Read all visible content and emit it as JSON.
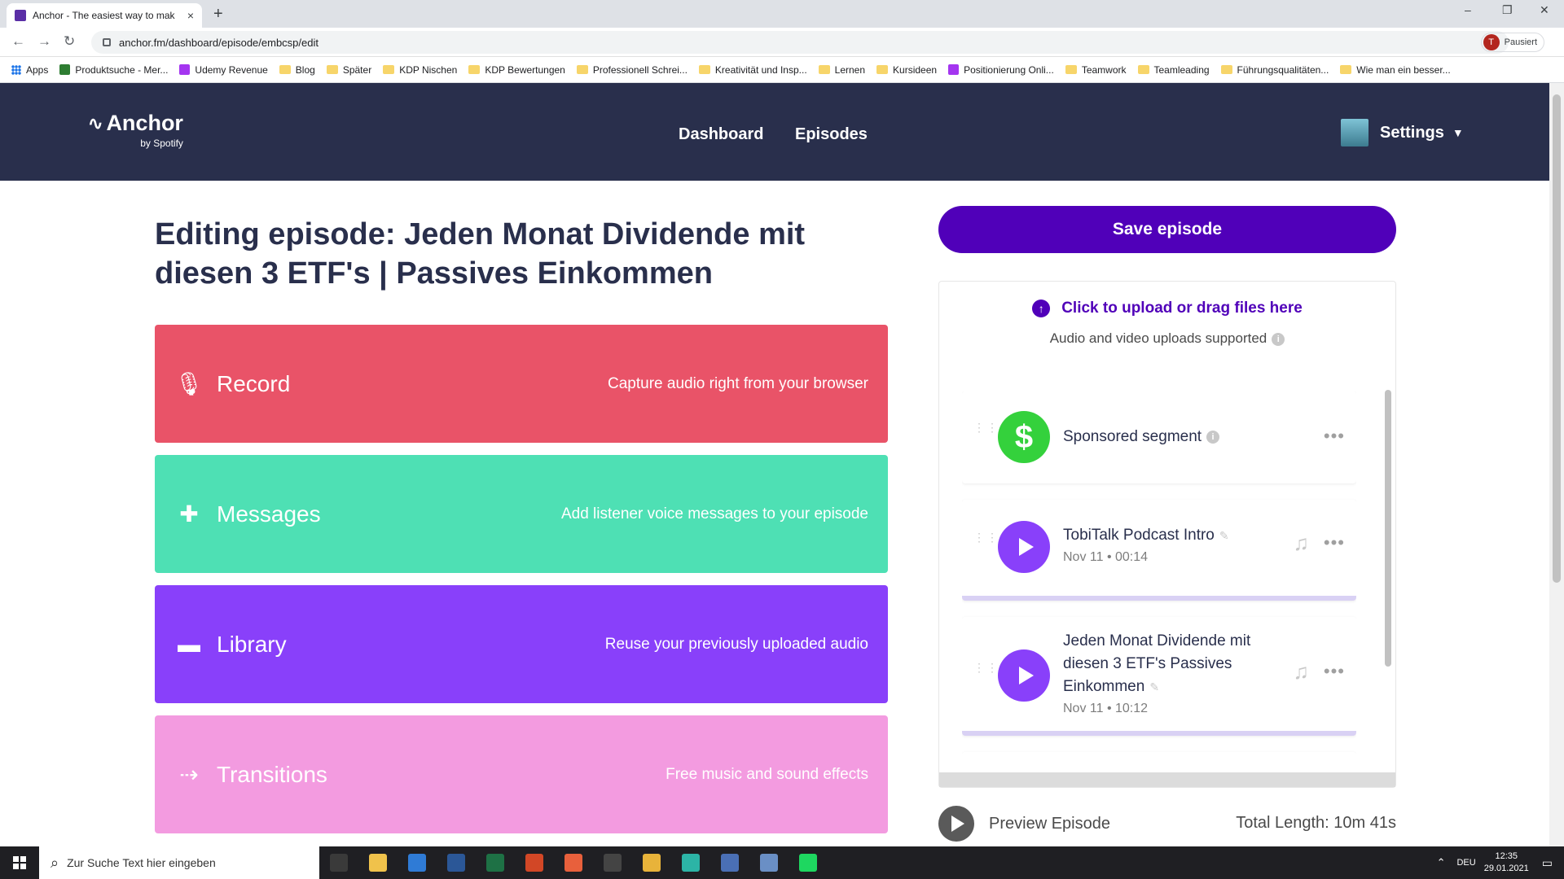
{
  "browser": {
    "tab_title": "Anchor - The easiest way to mak",
    "tab_close": "×",
    "new_tab": "+",
    "url": "anchor.fm/dashboard/episode/embcsp/edit",
    "profile_initial": "T",
    "profile_status": "Pausiert",
    "win_min": "–",
    "win_max": "❐",
    "win_close": "✕",
    "back": "←",
    "forward": "→",
    "reload": "↻",
    "bookmarks": [
      {
        "label": "Apps",
        "icon": "apps-grid-icon"
      },
      {
        "label": "Produktsuche - Mer...",
        "icon": "site-icon"
      },
      {
        "label": "Udemy Revenue",
        "icon": "udemy-icon"
      },
      {
        "label": "Blog",
        "icon": "folder-icon"
      },
      {
        "label": "Später",
        "icon": "folder-icon"
      },
      {
        "label": "KDP Nischen",
        "icon": "folder-icon"
      },
      {
        "label": "KDP Bewertungen",
        "icon": "folder-icon"
      },
      {
        "label": "Professionell Schrei...",
        "icon": "folder-icon"
      },
      {
        "label": "Kreativität und Insp...",
        "icon": "folder-icon"
      },
      {
        "label": "Lernen",
        "icon": "folder-icon"
      },
      {
        "label": "Kursideen",
        "icon": "folder-icon"
      },
      {
        "label": "Positionierung Onli...",
        "icon": "udemy-icon"
      },
      {
        "label": "Teamwork",
        "icon": "folder-icon"
      },
      {
        "label": "Teamleading",
        "icon": "folder-icon"
      },
      {
        "label": "Führungsqualitäten...",
        "icon": "folder-icon"
      },
      {
        "label": "Wie man ein besser...",
        "icon": "folder-icon"
      }
    ],
    "bookmarks_more": "»"
  },
  "header": {
    "logo": "Anchor",
    "logo_sub": "by Spotify",
    "nav": [
      "Dashboard",
      "Episodes"
    ],
    "settings": "Settings",
    "caret": "▼"
  },
  "page": {
    "title": "Editing episode: Jeden Monat Dividende mit diesen 3 ETF's | Passives Einkommen"
  },
  "cards": [
    {
      "label": "Record",
      "desc": "Capture audio right from your browser",
      "icon": "🎙",
      "color": "#e95368"
    },
    {
      "label": "Messages",
      "desc": "Add listener voice messages to your episode",
      "icon": "✚",
      "color": "#4ee0b4"
    },
    {
      "label": "Library",
      "desc": "Reuse your previously uploaded audio",
      "icon": "▬",
      "color": "#8940fa"
    },
    {
      "label": "Transitions",
      "desc": "Free music and sound effects",
      "icon": "⇢",
      "color": "#f39be0"
    }
  ],
  "panel": {
    "save": "Save episode",
    "upload": "Click to upload or drag files here",
    "upload_arrow": "↑",
    "upload_sub": "Audio and video uploads supported",
    "info": "i",
    "segments": [
      {
        "name": "Sponsored segment",
        "meta": "",
        "type": "sponsored",
        "dollar": "$"
      },
      {
        "name": "TobiTalk Podcast Intro",
        "meta": "Nov 11 • 00:14",
        "type": "audio"
      },
      {
        "name_lines": [
          "Jeden Monat Dividende mit",
          "diesen 3 ETF's Passives",
          "Einkommen"
        ],
        "meta": "Nov 11 • 10:12",
        "type": "audio"
      }
    ],
    "more": "•••",
    "music": "♫",
    "pencil": "✎",
    "drag": "⋮⋮",
    "preview": "Preview Episode",
    "total": "Total Length: 10m 41s"
  },
  "taskbar": {
    "search_placeholder": "Zur Suche Text hier eingeben",
    "search_icon": "⌕",
    "lang": "DEU",
    "time": "12:35",
    "date": "29.01.2021",
    "tray_up": "⌃",
    "notifications": "▭",
    "apps": [
      {
        "name": "task-view-icon",
        "color": "#3a3a3a"
      },
      {
        "name": "file-explorer-icon",
        "color": "#f0c24b"
      },
      {
        "name": "mail-icon",
        "color": "#2f7bd6"
      },
      {
        "name": "word-icon",
        "color": "#2b5797"
      },
      {
        "name": "excel-icon",
        "color": "#1e7145"
      },
      {
        "name": "powerpoint-icon",
        "color": "#d24726"
      },
      {
        "name": "app-icon",
        "color": "#e8603c"
      },
      {
        "name": "obs-icon",
        "color": "#444444"
      },
      {
        "name": "chrome-icon",
        "color": "#e8b33a"
      },
      {
        "name": "edge-icon",
        "color": "#2cb4a6"
      },
      {
        "name": "app-icon",
        "color": "#4a6fb5"
      },
      {
        "name": "app-icon",
        "color": "#6a8fc5"
      },
      {
        "name": "spotify-icon",
        "color": "#1ed760"
      }
    ]
  }
}
